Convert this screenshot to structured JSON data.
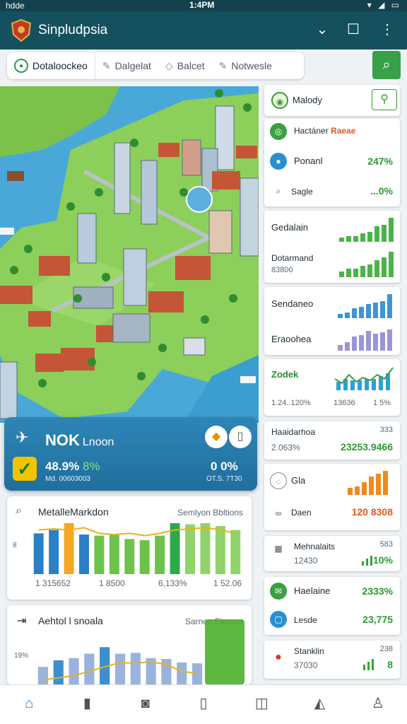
{
  "status": {
    "left": "hdde",
    "time": "1:4PM",
    "right": "▾ ◢ ▭"
  },
  "app": {
    "title": "Sinpludpsia"
  },
  "icons": {
    "logo": "shield-crest-icon",
    "chevron": "chevron-down-icon",
    "square": "square-icon",
    "more": "more-vert-icon",
    "search": "search-icon"
  },
  "tabs": [
    {
      "label": "Dotaloockeo"
    },
    {
      "label": "Dalgelat"
    },
    {
      "label": "Balcet"
    },
    {
      "label": "Notwesle"
    }
  ],
  "overlay": {
    "title": "NOK",
    "sub": "Lnoon",
    "value1": "48.9%",
    "value1b": "8%",
    "sub1": "Md. 00603003",
    "value2": "0  0%",
    "sub2": "OT.S. 7T30"
  },
  "card1": {
    "title": "MetalleMarkdon",
    "right": "Semlyon Bbltions",
    "labels": [
      "1 315652",
      "1 8500",
      "6,133%",
      "1 52.06"
    ],
    "ytick": "8",
    "chart_data": {
      "type": "bar",
      "categories": [
        "1",
        "2",
        "3",
        "4",
        "5",
        "6",
        "7",
        "8",
        "9",
        "10",
        "11",
        "12",
        "13",
        "14"
      ],
      "values": [
        72,
        78,
        90,
        70,
        68,
        70,
        62,
        60,
        68,
        90,
        88,
        90,
        85,
        78
      ],
      "line": [
        78,
        80,
        78,
        82,
        72,
        70,
        72,
        68,
        72,
        78,
        80,
        82,
        78,
        72
      ]
    }
  },
  "card2": {
    "title": "Aehtol l snoala",
    "right": "Sarnon Etenwe",
    "ytick": "19%",
    "chart_data": {
      "type": "bar",
      "categories": [
        "1",
        "2",
        "3",
        "4",
        "5",
        "6",
        "7",
        "8",
        "9",
        "10",
        "11"
      ],
      "values": [
        40,
        55,
        60,
        70,
        85,
        70,
        72,
        60,
        58,
        50,
        48
      ],
      "line": [
        10,
        15,
        20,
        30,
        40,
        50,
        48,
        52,
        45,
        30,
        25
      ]
    }
  },
  "right": {
    "r1": {
      "label": "Malody"
    },
    "r2": {
      "l1": "Hactáner",
      "l1b": "Raeae",
      "l2": "Ponanl",
      "v2": "247%",
      "l3": "Sagle",
      "v3": "...0%"
    },
    "r3": {
      "l1": "Gedalain",
      "l2": "Dotarmand",
      "s2": "83800"
    },
    "r4": {
      "l1": "Sendaneo",
      "l2": "Eraoohea"
    },
    "r5": {
      "l1": "Zodek",
      "a": "1.24..120%",
      "b": "13636",
      "c": "1 5%"
    },
    "r6": {
      "l1": "Haaidarhoa",
      "num": "333",
      "l2": "2.063%",
      "v2": "23253.9466"
    },
    "r7": {
      "l1": "Gla",
      "l2": "Daen",
      "v2": "120 8308"
    },
    "r8": {
      "l1": "Mehnalaits",
      "num": "583",
      "l2": "12430",
      "v2": "10%"
    },
    "r9": {
      "l1": "Haelaine",
      "v1": "2333%",
      "l2": "Lesde",
      "v2": "23,775"
    },
    "r10": {
      "l1": "Stanklin",
      "num": "238",
      "l2": "37030",
      "v2": "8"
    }
  },
  "nav": [
    "home-icon",
    "bookmark-icon",
    "camera-icon",
    "book-icon",
    "bag-icon",
    "map-icon",
    "profile-icon"
  ]
}
